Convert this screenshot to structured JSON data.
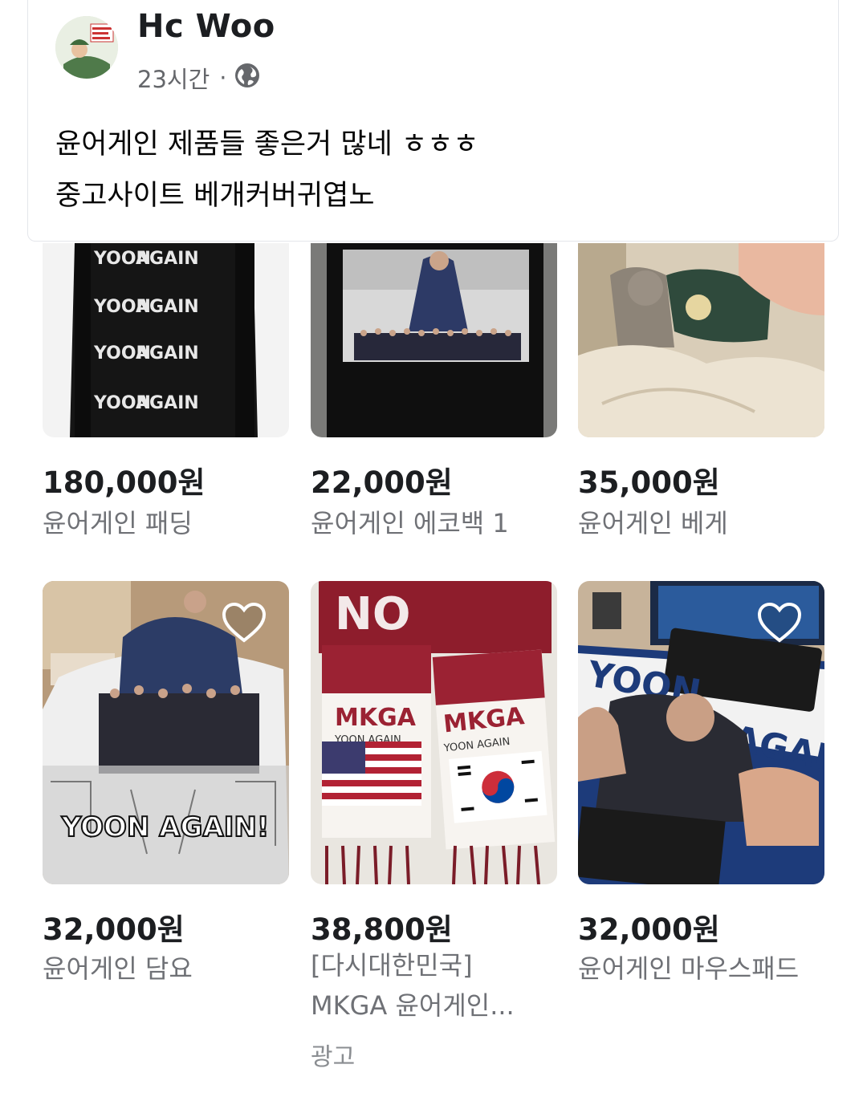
{
  "post": {
    "author": "Hc Woo",
    "time": "23시간",
    "separator": "·",
    "privacy_icon": "globe-icon",
    "text_line1": "윤어게인 제품들 좋은거 많네 ㅎㅎㅎ",
    "text_line2": "중고사이트 베개커버귀엽노"
  },
  "products": [
    {
      "price": "180,000원",
      "title": "윤어게인 패딩",
      "image_text": "YOON AGAIN"
    },
    {
      "price": "22,000원",
      "title": "윤어게인 에코백 1"
    },
    {
      "price": "35,000원",
      "title": "윤어게인 베게"
    },
    {
      "price": "32,000원",
      "title": "윤어게인 담요",
      "image_text": "YOON AGAIN!"
    },
    {
      "price": "38,800원",
      "title_line1": "[다시대한민국]",
      "title_line2": "MKGA 윤어게인...",
      "ad_label": "광고",
      "image_text_1": "MKGA",
      "image_text_2": "YOON AGAIN"
    },
    {
      "price": "32,000원",
      "title": "윤어게인 마우스패드",
      "image_text_1": "YOON",
      "image_text_2": "AGAI"
    }
  ],
  "colors": {
    "text": "#1c1e21",
    "muted": "#6f7176",
    "border": "#e4e6eb"
  }
}
